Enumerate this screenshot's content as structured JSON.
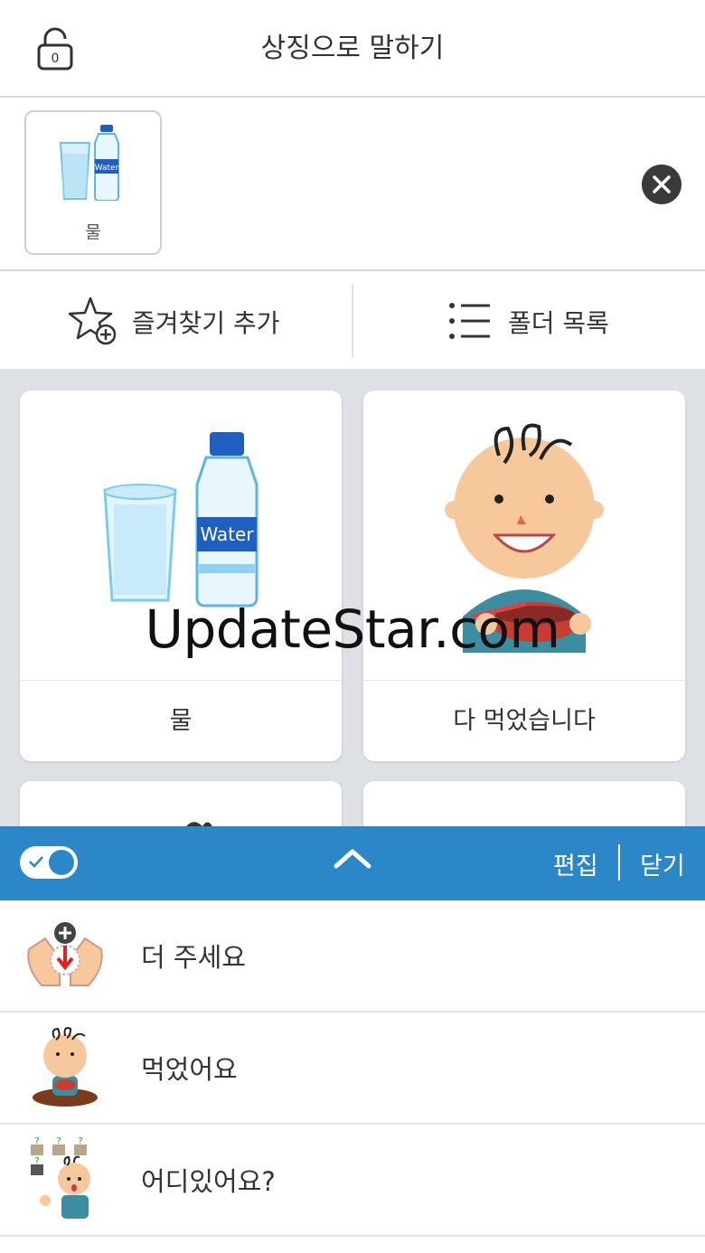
{
  "header": {
    "title": "상징으로 말하기",
    "lock_digit": "0"
  },
  "sentence_strip": {
    "items": [
      {
        "label": "물"
      }
    ]
  },
  "toolbar": {
    "favorite_label": "즐겨찾기 추가",
    "folder_label": "폴더 목록"
  },
  "grid": {
    "cards": [
      {
        "label": "물"
      },
      {
        "label": "다 먹었습니다"
      }
    ]
  },
  "watermark": "UpdateStar.com",
  "bottom_bar": {
    "toggle_on": true,
    "edit_label": "편집",
    "close_label": "닫기"
  },
  "list": {
    "items": [
      {
        "label": "더 주세요"
      },
      {
        "label": "먹었어요"
      },
      {
        "label": "어디있어요?"
      }
    ]
  },
  "colors": {
    "accent": "#2b87c8",
    "grid_bg": "#dde0e4"
  }
}
